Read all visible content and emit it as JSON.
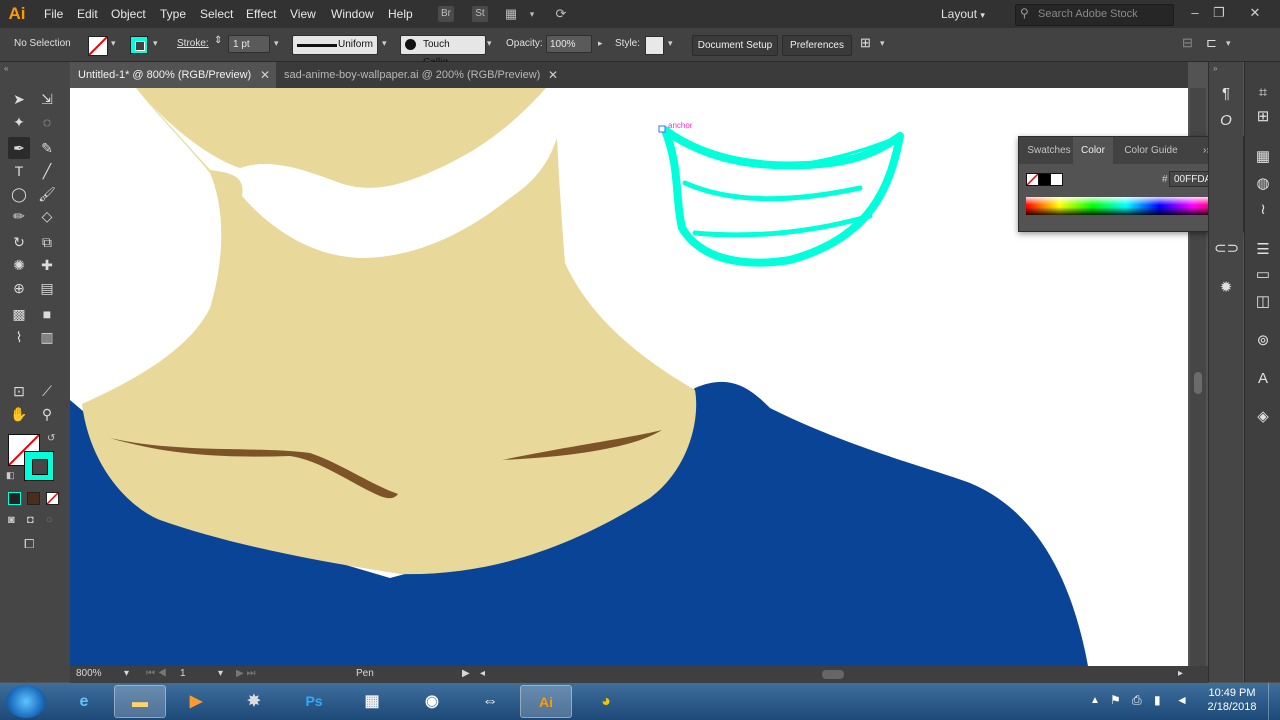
{
  "menubar": {
    "logo": "Ai",
    "items": [
      "File",
      "Edit",
      "Object",
      "Type",
      "Select",
      "Effect",
      "View",
      "Window",
      "Help"
    ],
    "icons": {
      "bridge": "Br",
      "stock": "St"
    },
    "layout_label": "Layout",
    "search_placeholder": "Search Adobe Stock"
  },
  "controlbar": {
    "selection": "No Selection",
    "stroke_label": "Stroke:",
    "stroke_weight": "1 pt",
    "stroke_profile": "Uniform",
    "brush": "Touch Callig...",
    "opacity_label": "Opacity:",
    "opacity_value": "100%",
    "style_label": "Style:",
    "document_setup": "Document Setup",
    "preferences": "Preferences",
    "stroke_color": "#00FFDA"
  },
  "tabs": [
    {
      "label": "Untitled-1* @ 800% (RGB/Preview)",
      "active": true
    },
    {
      "label": "sad-anime-boy-wallpaper.ai @ 200% (RGB/Preview)",
      "active": false
    }
  ],
  "canvas": {
    "anchor_label": "anchor",
    "colors": {
      "skin": "#E8D89A",
      "shirt": "#0A4496",
      "brow": "#7D5428",
      "smile": "#00FFDA",
      "page": "#FFFFFF"
    }
  },
  "color_panel": {
    "tabs": [
      "Swatches",
      "Color",
      "Color Guide"
    ],
    "active_tab": "Color",
    "hex_symbol": "#",
    "hex_value": "00FFDA"
  },
  "statusbar": {
    "zoom": "800%",
    "artboard": "1",
    "tool_name": "Pen"
  },
  "taskbar": {
    "apps": [
      "IE",
      "Explorer",
      "Media",
      "App",
      "Ps",
      "Video",
      "Discord",
      "TeamViewer",
      "Ai",
      "Chrome"
    ],
    "time": "10:49 PM",
    "date": "2/18/2018"
  }
}
